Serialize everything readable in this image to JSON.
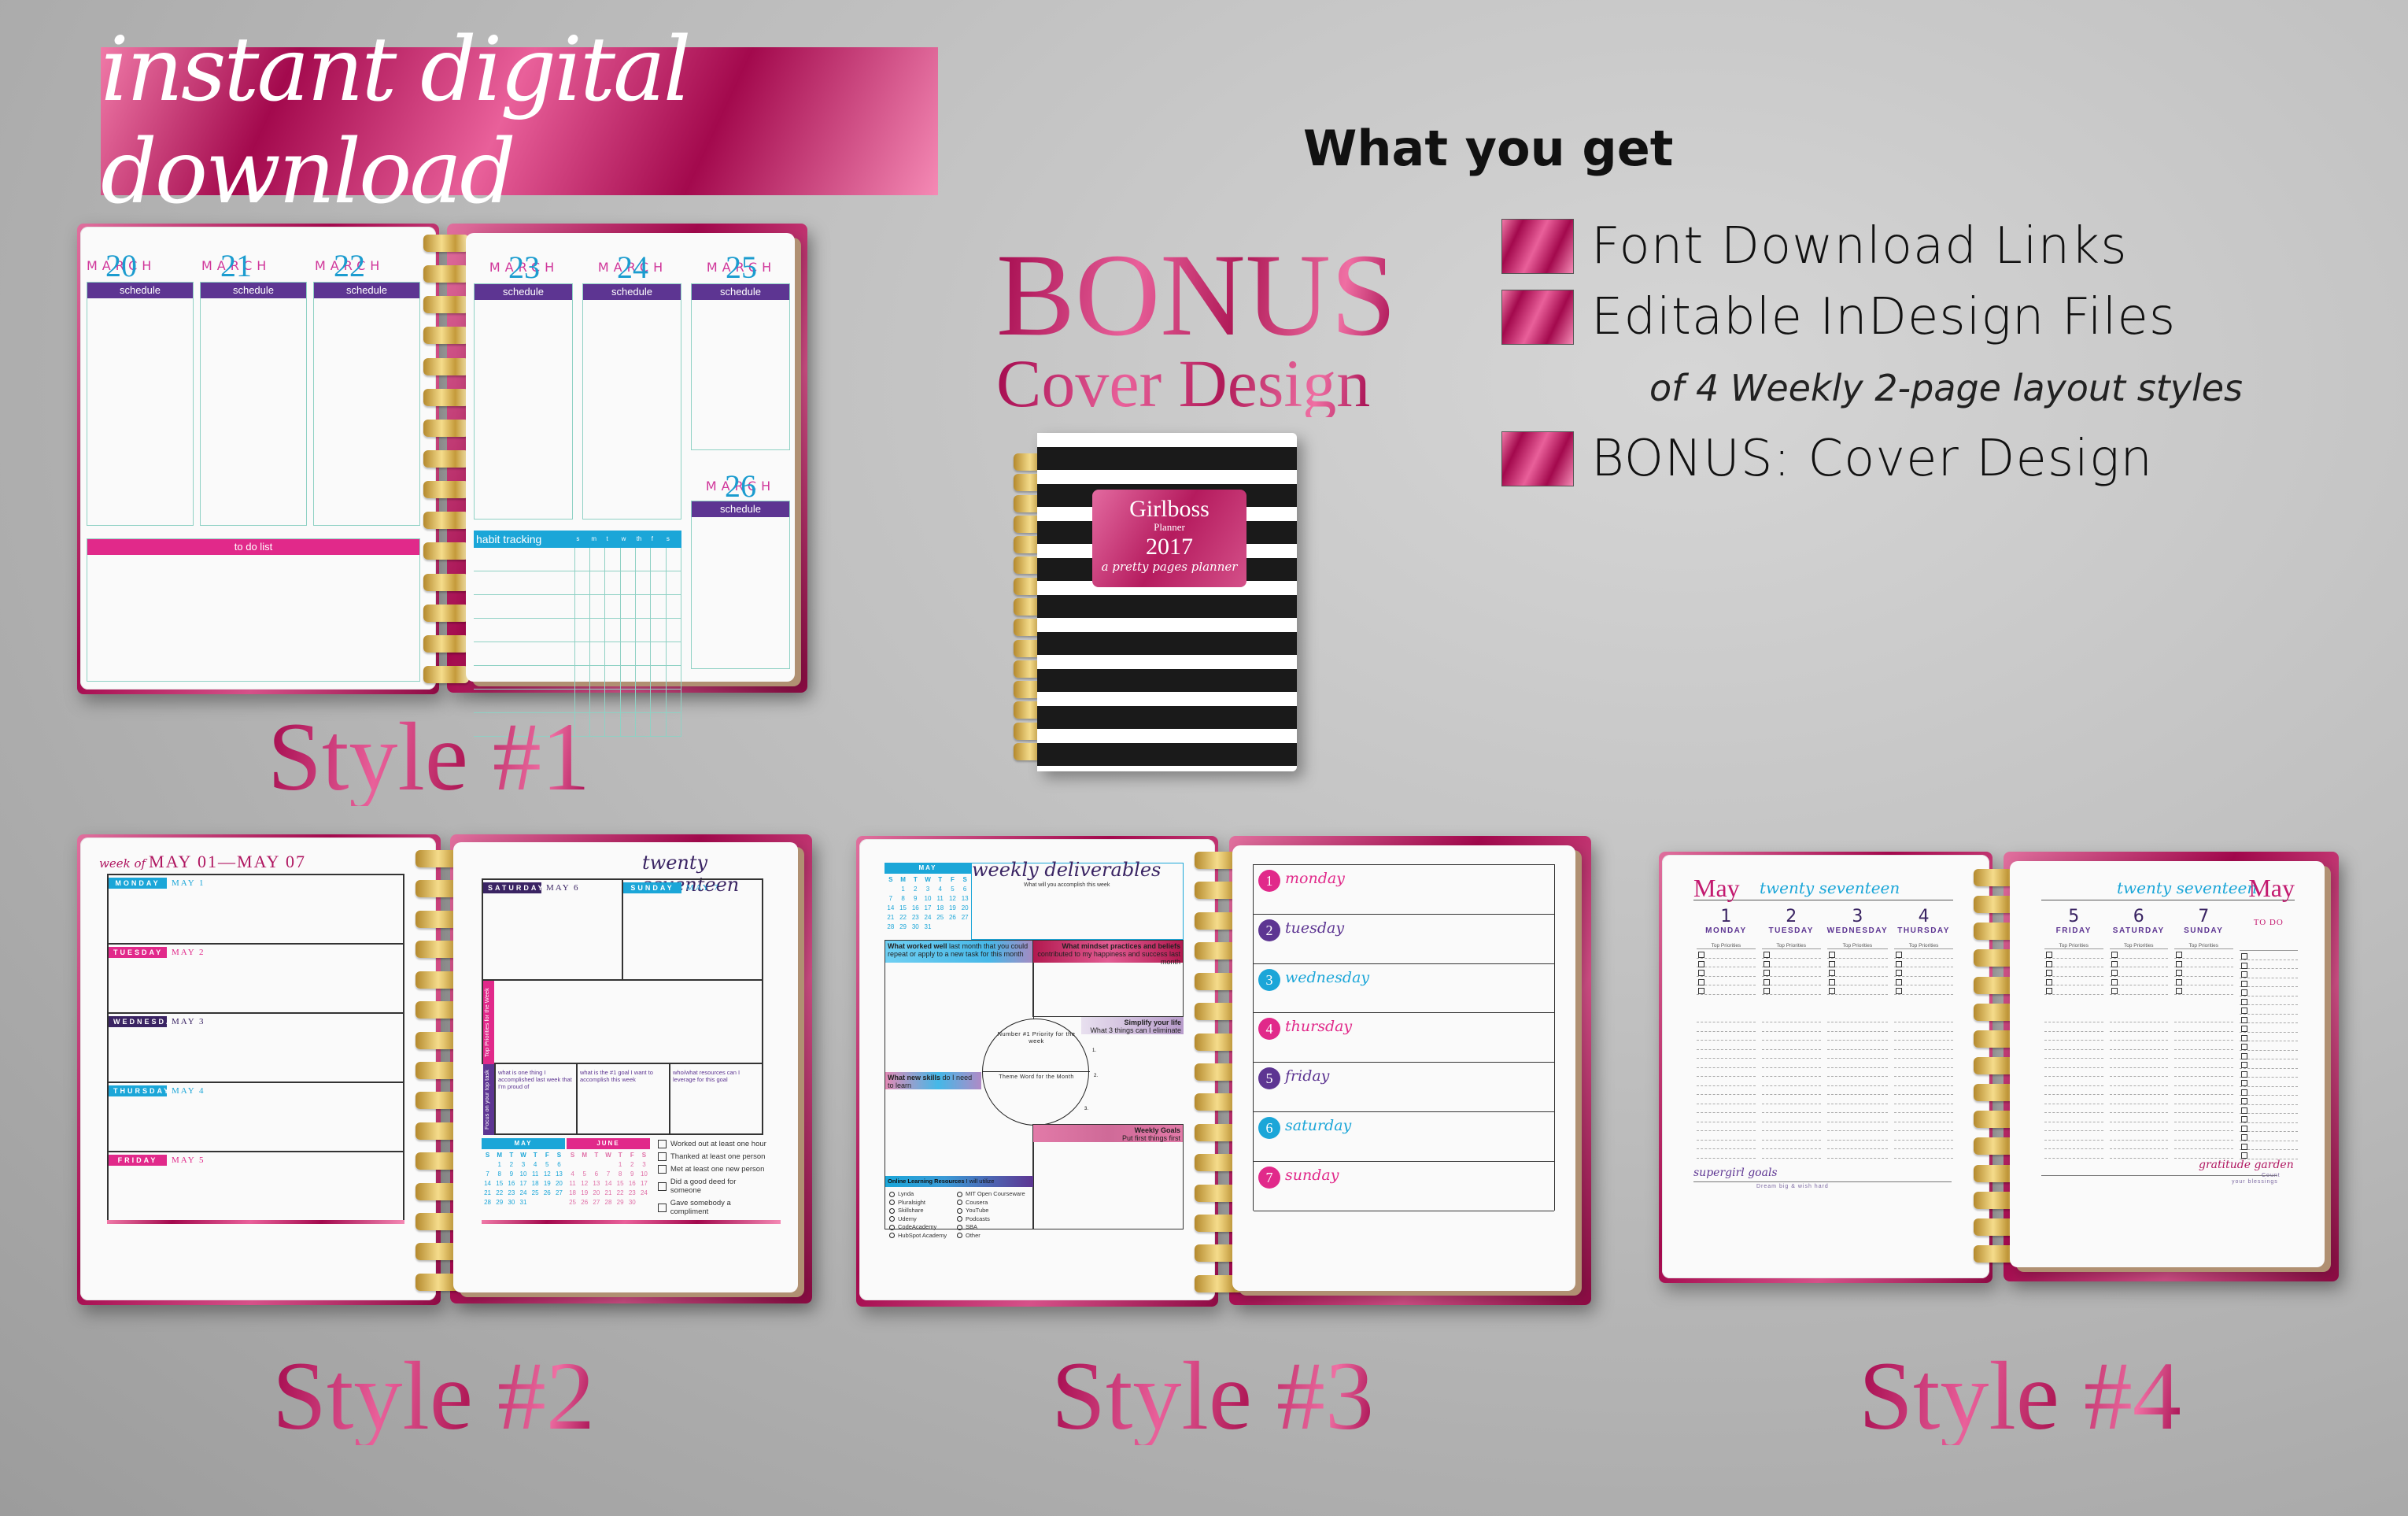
{
  "banner": {
    "text": "instant digital download"
  },
  "what_you_get": {
    "title": "What you get",
    "items": [
      {
        "label": "Font Download Links",
        "icon": "pink-square-bullet"
      },
      {
        "label": "Editable InDesign Files",
        "icon": "pink-square-bullet",
        "subtext": "of 4 Weekly 2-page layout styles"
      },
      {
        "label": "BONUS: Cover Design",
        "icon": "pink-square-bullet"
      }
    ]
  },
  "bonus": {
    "line1": "BONUS",
    "line2": "Cover Design"
  },
  "cover": {
    "title": "Girlboss",
    "subtitle": "Planner",
    "year": "2017",
    "tagline": "a pretty pages planner"
  },
  "colors": {
    "accent_pink": "#e1298a",
    "foil_pink": "#a3094d",
    "purple": "#5d3592",
    "blue": "#1ba6d8",
    "teal_line": "#8fd1c4"
  },
  "style1": {
    "label": "Style #1",
    "month": "MARCH",
    "days": [
      "20",
      "21",
      "22",
      "23",
      "24",
      "25",
      "26"
    ],
    "schedule_label": "schedule",
    "todo_label": "to do list",
    "habit_label": "habit tracking",
    "habit_days": [
      "s",
      "m",
      "t",
      "w",
      "th",
      "f",
      "s"
    ]
  },
  "style2": {
    "label": "Style #2",
    "week_prefix": "week of",
    "week_range": "MAY 01—MAY 07",
    "year_script": "twenty seventeen",
    "days": [
      {
        "name": "MONDAY",
        "date": "MAY 1",
        "color": "#1ba6d8"
      },
      {
        "name": "TUESDAY",
        "date": "MAY 2",
        "color": "#e1298a"
      },
      {
        "name": "WEDNESDAY",
        "date": "MAY 3",
        "color": "#3a2463"
      },
      {
        "name": "THURSDAY",
        "date": "MAY 4",
        "color": "#1ba6d8"
      },
      {
        "name": "FRIDAY",
        "date": "MAY 5",
        "color": "#e1298a"
      },
      {
        "name": "SATURDAY",
        "date": "MAY 6",
        "color": "#3a2463"
      },
      {
        "name": "SUNDAY",
        "date": "MAY 7",
        "color": "#1ba6d8"
      }
    ],
    "top_priorities": "Top Priorities for the Week",
    "focus": "Focus on your top task",
    "prompts": [
      "what is one thing I accomplished last week that I'm proud of",
      "what is the #1 goal I want to accomplish this week",
      "who/what resources can I leverage for this goal"
    ],
    "cal_may": {
      "title": "MAY",
      "weekdays": [
        "S",
        "M",
        "T",
        "W",
        "T",
        "F",
        "S"
      ],
      "cells": [
        "",
        "1",
        "2",
        "3",
        "4",
        "5",
        "6",
        "7",
        "8",
        "9",
        "10",
        "11",
        "12",
        "13",
        "14",
        "15",
        "16",
        "17",
        "18",
        "19",
        "20",
        "21",
        "22",
        "23",
        "24",
        "25",
        "26",
        "27",
        "28",
        "29",
        "30",
        "31"
      ]
    },
    "cal_june": {
      "title": "JUNE",
      "weekdays": [
        "S",
        "M",
        "T",
        "W",
        "T",
        "F",
        "S"
      ],
      "cells": [
        "",
        "",
        "",
        "",
        "1",
        "2",
        "3",
        "4",
        "5",
        "6",
        "7",
        "8",
        "9",
        "10",
        "11",
        "12",
        "13",
        "14",
        "15",
        "16",
        "17",
        "18",
        "19",
        "20",
        "21",
        "22",
        "23",
        "24",
        "25",
        "26",
        "27",
        "28",
        "29",
        "30"
      ]
    },
    "checklist": [
      "Worked out at least one hour",
      "Thanked at least one person",
      "Met at least one new person",
      "Did a good deed for someone",
      "Gave somebody a compliment"
    ]
  },
  "style3": {
    "label": "Style #3",
    "cal_may": {
      "title": "MAY",
      "weekdays": [
        "S",
        "M",
        "T",
        "W",
        "T",
        "F",
        "S"
      ],
      "cells": [
        "",
        "1",
        "2",
        "3",
        "4",
        "5",
        "6",
        "7",
        "8",
        "9",
        "10",
        "11",
        "12",
        "13",
        "14",
        "15",
        "16",
        "17",
        "18",
        "19",
        "20",
        "21",
        "22",
        "23",
        "24",
        "25",
        "26",
        "27",
        "28",
        "29",
        "30",
        "31"
      ]
    },
    "deliverables_script": "weekly deliverables",
    "deliverables_sub": "What will you accomplish this week",
    "worked_well_bold": "What worked well",
    "worked_well_rest": "last month that you could repeat or apply to a new task for this month",
    "mindset_bold": "What mindset practices and beliefs",
    "mindset_rest": "contributed to my happiness and success last month",
    "simplify_bold": "Simplify your life",
    "simplify_rest": "What 3 things can I eliminate",
    "priority_arc": "Number #1 Priority for the week",
    "theme_word": "Theme Word for the Month",
    "numbers": [
      "1.",
      "2.",
      "3."
    ],
    "skills_bold": "What new skills",
    "skills_rest": "do I need to learn",
    "goals_bold": "Weekly Goals",
    "goals_rest": "Put first things first",
    "resources_bold": "Online Learning Resources",
    "resources_rest": "I will utilize",
    "resources_col1": [
      "Lynda",
      "Pluralsight",
      "Skillshare",
      "Udemy",
      "CodeAcademy",
      "HubSpot Academy"
    ],
    "resources_col2": [
      "MIT Open Courseware",
      "Cousera",
      "YouTube",
      "Podcasts",
      "SBA",
      "Other"
    ],
    "weekdays": [
      {
        "num": "1",
        "name": "monday",
        "color": "#e1298a"
      },
      {
        "num": "2",
        "name": "tuesday",
        "color": "#5d3592"
      },
      {
        "num": "3",
        "name": "wednesday",
        "color": "#1ba6d8"
      },
      {
        "num": "4",
        "name": "thursday",
        "color": "#e1298a"
      },
      {
        "num": "5",
        "name": "friday",
        "color": "#5d3592"
      },
      {
        "num": "6",
        "name": "saturday",
        "color": "#1ba6d8"
      },
      {
        "num": "7",
        "name": "sunday",
        "color": "#e1298a"
      }
    ]
  },
  "style4": {
    "label": "Style #4",
    "month": "May",
    "year_script": "twenty seventeen",
    "left_days": [
      {
        "num": "1",
        "name": "MONDAY"
      },
      {
        "num": "2",
        "name": "TUESDAY"
      },
      {
        "num": "3",
        "name": "WEDNESDAY"
      },
      {
        "num": "4",
        "name": "THURSDAY"
      }
    ],
    "right_days": [
      {
        "num": "5",
        "name": "FRIDAY"
      },
      {
        "num": "6",
        "name": "SATURDAY"
      },
      {
        "num": "7",
        "name": "SUNDAY"
      }
    ],
    "top_priorities": "Top Priorities",
    "todo_label": "TO DO",
    "goals_script": "supergirl goals",
    "goals_sub": "Dream big & wish hard",
    "gratitude_script": "gratitude garden",
    "gratitude_sub1": "Count",
    "gratitude_sub2": "your blessings"
  }
}
